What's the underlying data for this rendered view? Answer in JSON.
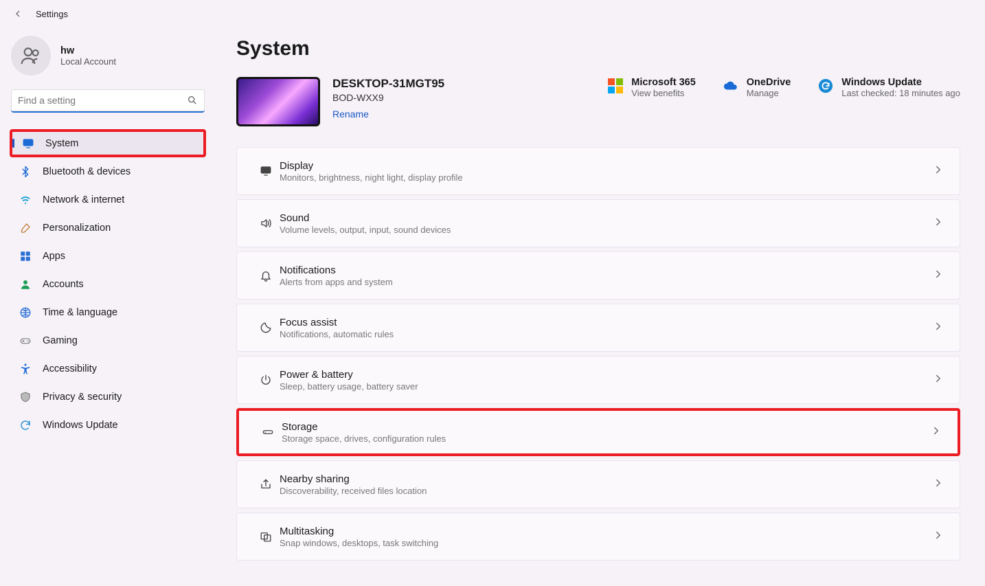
{
  "app": {
    "title": "Settings"
  },
  "profile": {
    "name": "hw",
    "account": "Local Account"
  },
  "search": {
    "placeholder": "Find a setting"
  },
  "sidebar": {
    "items": [
      {
        "label": "System",
        "icon": "monitor",
        "color": "#1a6bd6",
        "selected": true,
        "highlight": true
      },
      {
        "label": "Bluetooth & devices",
        "icon": "bluetooth",
        "color": "#1a6bd6"
      },
      {
        "label": "Network & internet",
        "icon": "wifi",
        "color": "#2aa8d8"
      },
      {
        "label": "Personalization",
        "icon": "brush",
        "color": "#c27e3a"
      },
      {
        "label": "Apps",
        "icon": "apps",
        "color": "#2a6fd6"
      },
      {
        "label": "Accounts",
        "icon": "person",
        "color": "#1f9e5a"
      },
      {
        "label": "Time & language",
        "icon": "clock-globe",
        "color": "#2a6fd6"
      },
      {
        "label": "Gaming",
        "icon": "gamepad",
        "color": "#888"
      },
      {
        "label": "Accessibility",
        "icon": "accessibility",
        "color": "#1a6bd6"
      },
      {
        "label": "Privacy & security",
        "icon": "shield",
        "color": "#888"
      },
      {
        "label": "Windows Update",
        "icon": "sync",
        "color": "#1a8ad6"
      }
    ]
  },
  "page": {
    "title": "System",
    "device": {
      "name": "DESKTOP-31MGT95",
      "model": "BOD-WXX9",
      "rename": "Rename"
    },
    "cloud_links": [
      {
        "id": "microsoft-365",
        "title": "Microsoft 365",
        "sub": "View benefits",
        "icon": "ms365"
      },
      {
        "id": "onedrive",
        "title": "OneDrive",
        "sub": "Manage",
        "icon": "cloud"
      },
      {
        "id": "windows-update",
        "title": "Windows Update",
        "sub": "Last checked: 18 minutes ago",
        "icon": "sync-circle"
      }
    ],
    "cards": [
      {
        "id": "display",
        "title": "Display",
        "sub": "Monitors, brightness, night light, display profile",
        "icon": "monitor"
      },
      {
        "id": "sound",
        "title": "Sound",
        "sub": "Volume levels, output, input, sound devices",
        "icon": "speaker"
      },
      {
        "id": "notifications",
        "title": "Notifications",
        "sub": "Alerts from apps and system",
        "icon": "bell"
      },
      {
        "id": "focus-assist",
        "title": "Focus assist",
        "sub": "Notifications, automatic rules",
        "icon": "moon"
      },
      {
        "id": "power-battery",
        "title": "Power & battery",
        "sub": "Sleep, battery usage, battery saver",
        "icon": "power"
      },
      {
        "id": "storage",
        "title": "Storage",
        "sub": "Storage space, drives, configuration rules",
        "icon": "drive",
        "highlight": true
      },
      {
        "id": "nearby-sharing",
        "title": "Nearby sharing",
        "sub": "Discoverability, received files location",
        "icon": "share"
      },
      {
        "id": "multitasking",
        "title": "Multitasking",
        "sub": "Snap windows, desktops, task switching",
        "icon": "multitask"
      }
    ]
  }
}
